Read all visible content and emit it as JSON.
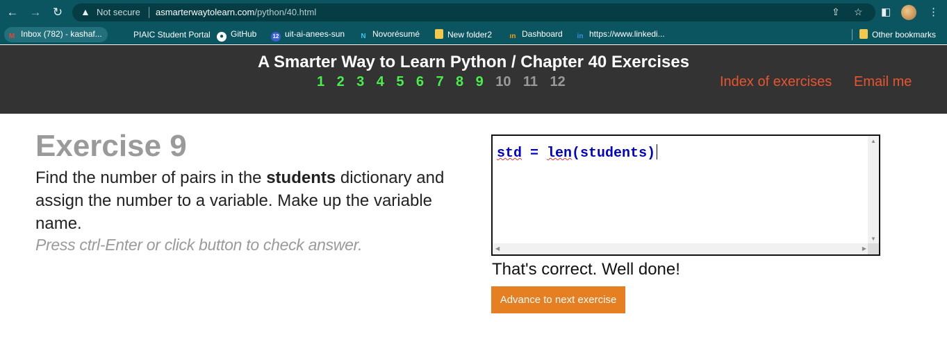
{
  "browser": {
    "not_secure": "Not secure",
    "url_domain": "asmarterwaytolearn.com",
    "url_path": "/python/40.html",
    "icons": [
      "back-icon",
      "forward-icon",
      "reload-icon",
      "warning-icon",
      "share-icon",
      "star-icon",
      "sidepanel-icon",
      "menu-icon"
    ]
  },
  "bookmarks": {
    "items": [
      {
        "label": "Inbox (782) - kashaf...",
        "icon": "gmail-icon",
        "color": "#ea4335"
      },
      {
        "label": "PIAIC Student Portal",
        "icon": "piaic-icon",
        "color": "#0b5560"
      },
      {
        "label": "GitHub",
        "icon": "github-icon",
        "color": "#ffffff"
      },
      {
        "label": "uit-ai-anees-sun",
        "icon": "badge-icon",
        "color": "#e8453c"
      },
      {
        "label": "Novorésumé",
        "icon": "novoresume-icon",
        "color": "#3fc3ee"
      },
      {
        "label": "New folder2",
        "icon": "folder-icon",
        "color": "#f2c94c"
      },
      {
        "label": "Dashboard",
        "icon": "dashboard-icon",
        "color": "#f59e0b"
      },
      {
        "label": "https://www.linkedi...",
        "icon": "linkedin-icon",
        "color": "#0a66c2"
      }
    ],
    "other": "Other bookmarks"
  },
  "header": {
    "title": "A Smarter Way to Learn Python / Chapter 40 Exercises",
    "chapters_done": [
      "1",
      "2",
      "3",
      "4",
      "5",
      "6",
      "7",
      "8",
      "9"
    ],
    "chapters_todo": [
      "10",
      "11",
      "12"
    ],
    "index_link": "Index of exercises",
    "email_link": "Email me"
  },
  "exercise": {
    "title": "Exercise 9",
    "desc_before": "Find the number of pairs in the ",
    "desc_bold": "students",
    "desc_after": " dictionary and assign the number to a variable. Make up the variable name.",
    "hint": "Press ctrl-Enter or click button to check answer."
  },
  "editor": {
    "code_var": "std",
    "code_mid": " = ",
    "code_fn": "len",
    "code_rest": "(students)"
  },
  "result": {
    "feedback": "That's correct. Well done!",
    "advance_button": "Advance to next exercise"
  },
  "colors": {
    "browser_bar": "#0b5560",
    "header_bg": "#333333",
    "chapter_done": "#47f04a",
    "chapter_todo": "#9a9a9a",
    "link": "#e8552e",
    "code": "#0000cc",
    "button": "#e67e22"
  }
}
